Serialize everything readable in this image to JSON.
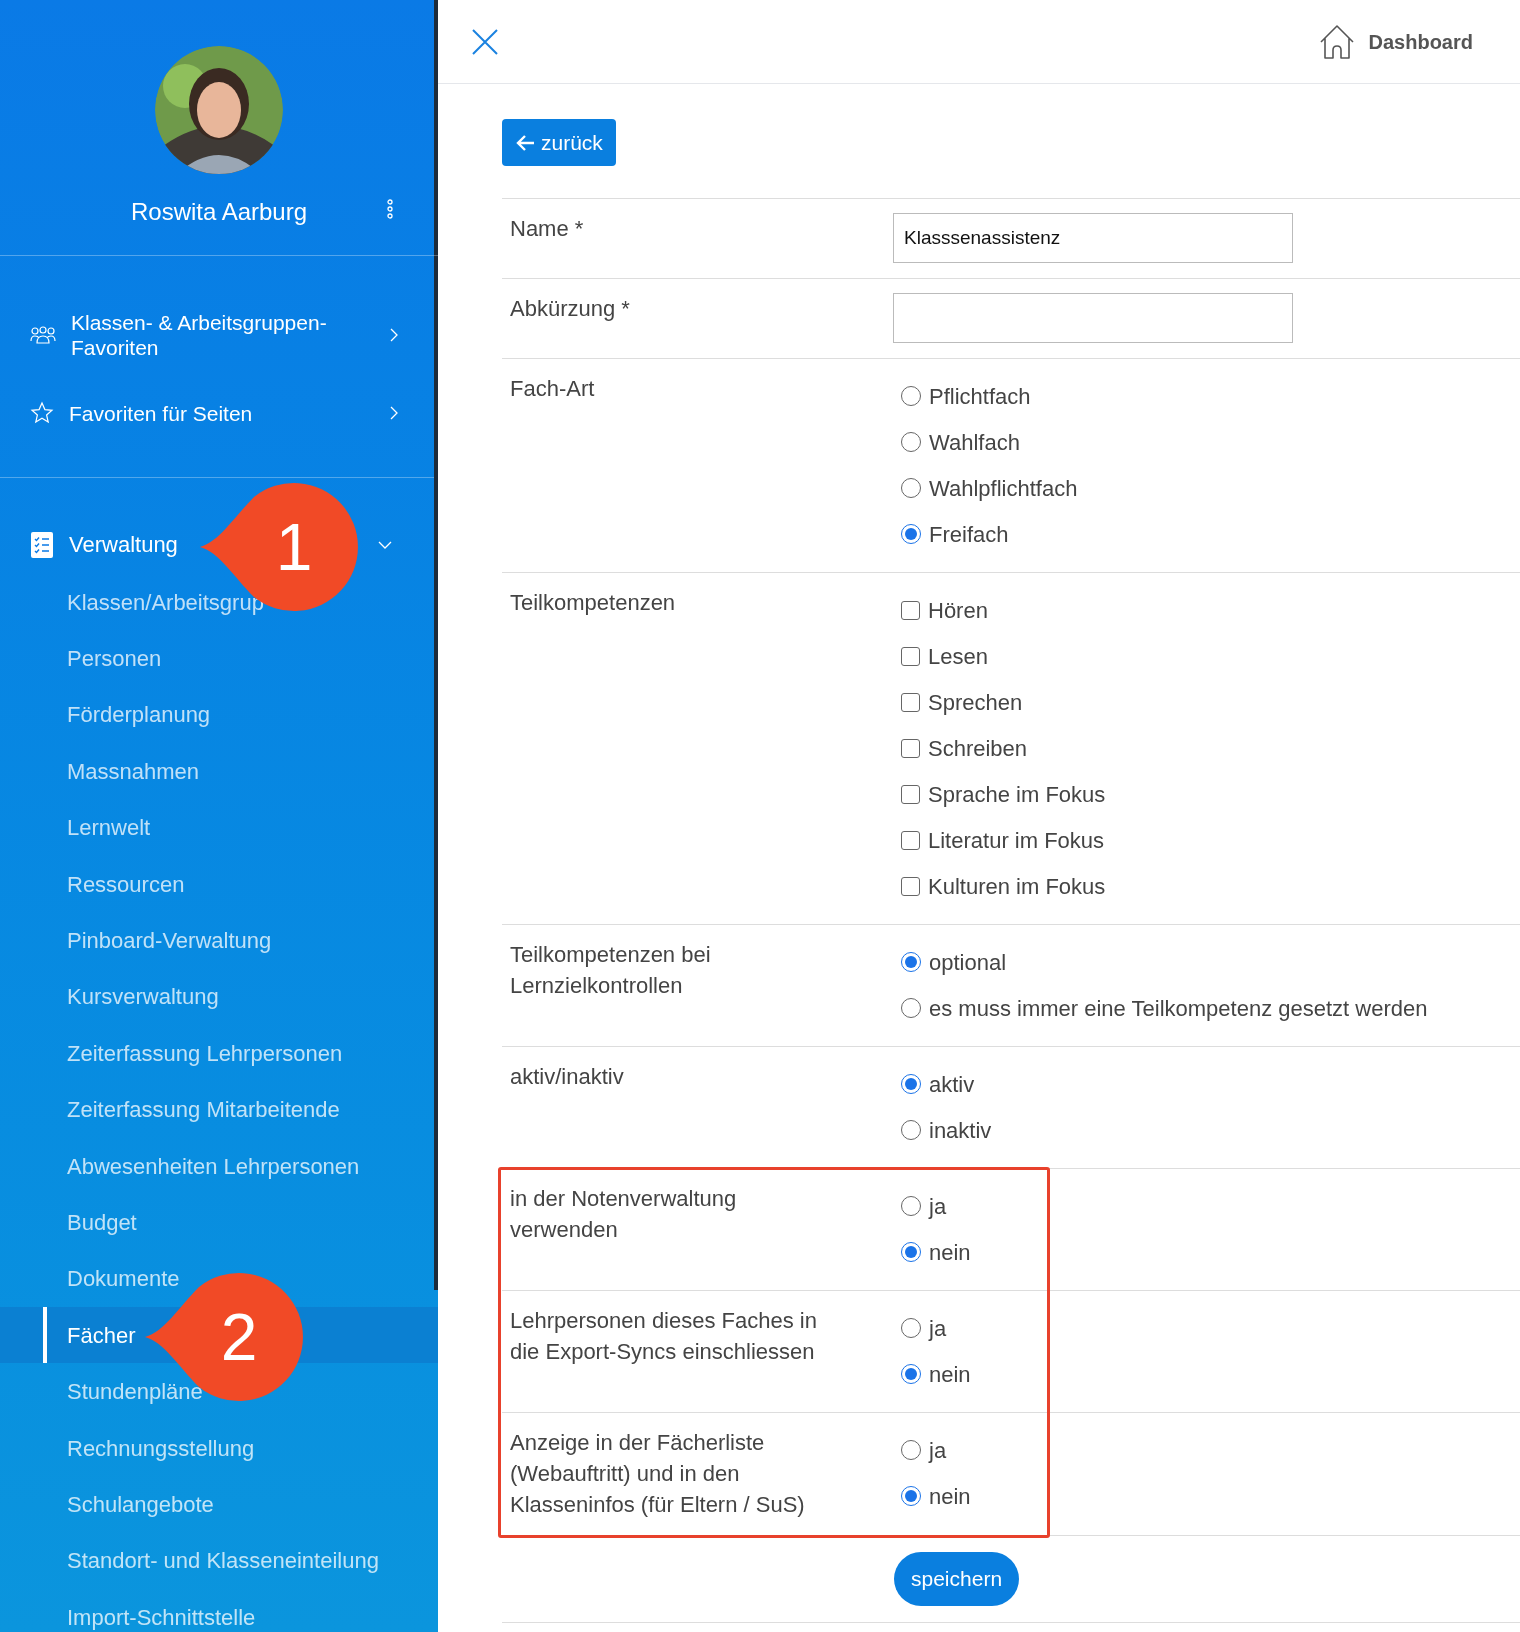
{
  "sidebar": {
    "user_name": "Roswita Aarburg",
    "favorites": [
      {
        "kind": "groups",
        "label": "Klassen- & Arbeitsgruppen-Favoriten"
      },
      {
        "kind": "star",
        "label": "Favoriten für Seiten"
      }
    ],
    "section": {
      "label": "Verwaltung",
      "expanded": true,
      "callout": "1",
      "items": [
        {
          "label": "Klassen/Arbeitsgrup",
          "selected": false
        },
        {
          "label": "Personen",
          "selected": false
        },
        {
          "label": "Förderplanung",
          "selected": false
        },
        {
          "label": "Massnahmen",
          "selected": false
        },
        {
          "label": "Lernwelt",
          "selected": false
        },
        {
          "label": "Ressourcen",
          "selected": false
        },
        {
          "label": "Pinboard-Verwaltung",
          "selected": false
        },
        {
          "label": "Kursverwaltung",
          "selected": false
        },
        {
          "label": "Zeiterfassung Lehrpersonen",
          "selected": false
        },
        {
          "label": "Zeiterfassung Mitarbeitende",
          "selected": false
        },
        {
          "label": "Abwesenheiten Lehrpersonen",
          "selected": false
        },
        {
          "label": "Budget",
          "selected": false
        },
        {
          "label": "Dokumente",
          "selected": false
        },
        {
          "label": "Fächer",
          "selected": true,
          "callout": "2"
        },
        {
          "label": "Stundenpläne",
          "selected": false
        },
        {
          "label": "Rechnungsstellung",
          "selected": false
        },
        {
          "label": "Schulangebote",
          "selected": false
        },
        {
          "label": "Standort- und Klasseneinteilung",
          "selected": false
        },
        {
          "label": "Import-Schnittstelle",
          "selected": false
        }
      ]
    }
  },
  "header": {
    "link": "Dashboard"
  },
  "back_button": "zurück",
  "form": {
    "rows": [
      {
        "label": "Name *",
        "kind": "text",
        "value": "Klasssenassistenz",
        "highlighted": false
      },
      {
        "label": "Abkürzung *",
        "kind": "text",
        "highlighted": false
      },
      {
        "label": "Fach-Art",
        "kind": "radio",
        "highlighted": false,
        "options": [
          {
            "label": "Pflichtfach",
            "selected": false
          },
          {
            "label": "Wahlfach",
            "selected": false
          },
          {
            "label": "Wahlpflichtfach",
            "selected": false
          },
          {
            "label": "Freifach",
            "selected": true
          }
        ]
      },
      {
        "label": "Teilkompetenzen",
        "kind": "checkbox",
        "highlighted": false,
        "options": [
          {
            "label": "Hören",
            "checked": false
          },
          {
            "label": "Lesen",
            "checked": false
          },
          {
            "label": "Sprechen",
            "checked": false
          },
          {
            "label": "Schreiben",
            "checked": false
          },
          {
            "label": "Sprache im Fokus",
            "checked": false
          },
          {
            "label": "Literatur im Fokus",
            "checked": false
          },
          {
            "label": "Kulturen im Fokus",
            "checked": false
          }
        ]
      },
      {
        "label": "Teilkompetenzen bei Lernzielkontrollen",
        "kind": "radio",
        "highlighted": false,
        "options": [
          {
            "label": "optional",
            "selected": true
          },
          {
            "label": "es muss immer eine Teilkompetenz gesetzt werden",
            "selected": false
          }
        ]
      },
      {
        "label": "aktiv/inaktiv",
        "kind": "radio",
        "highlighted": false,
        "options": [
          {
            "label": "aktiv",
            "selected": true
          },
          {
            "label": "inaktiv",
            "selected": false
          }
        ]
      },
      {
        "label": "in der Notenverwaltung verwenden",
        "kind": "radio",
        "highlighted": true,
        "options": [
          {
            "label": "ja",
            "selected": false
          },
          {
            "label": "nein",
            "selected": true
          }
        ]
      },
      {
        "label": "Lehrpersonen dieses Faches in die Export-Syncs einschliessen",
        "kind": "radio",
        "highlighted": true,
        "options": [
          {
            "label": "ja",
            "selected": false
          },
          {
            "label": "nein",
            "selected": true
          }
        ]
      },
      {
        "label": "Anzeige in der Fächerliste (Webauftritt) und in den Klasseninfos (für Eltern / SuS)",
        "kind": "radio",
        "highlighted": true,
        "options": [
          {
            "label": "ja",
            "selected": false
          },
          {
            "label": "nein",
            "selected": true
          }
        ]
      }
    ],
    "save_button": "speichern"
  }
}
